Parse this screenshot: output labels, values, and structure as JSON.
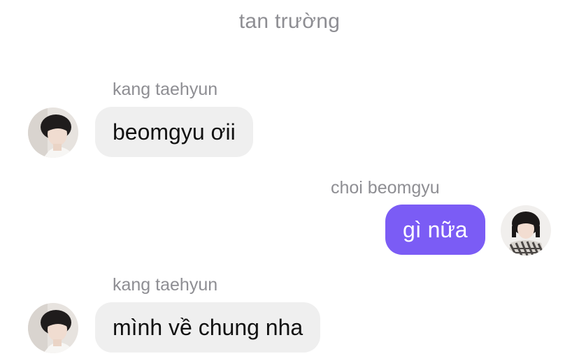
{
  "conversation": {
    "timestamp": "tan trường"
  },
  "messages": [
    {
      "sender": "kang taehyun",
      "text": "beomgyu ơii",
      "direction": "incoming",
      "avatar": "avatar-kang-taehyun"
    },
    {
      "sender": "choi beomgyu",
      "text": "gì nữa",
      "direction": "outgoing",
      "avatar": "avatar-choi-beomgyu"
    },
    {
      "sender": "kang taehyun",
      "text": "mình về chung nha",
      "direction": "incoming",
      "avatar": "avatar-kang-taehyun"
    }
  ],
  "colors": {
    "outgoing_bubble": "#7b5cf5",
    "incoming_bubble": "#efefef",
    "meta_text": "#8e8e93"
  }
}
